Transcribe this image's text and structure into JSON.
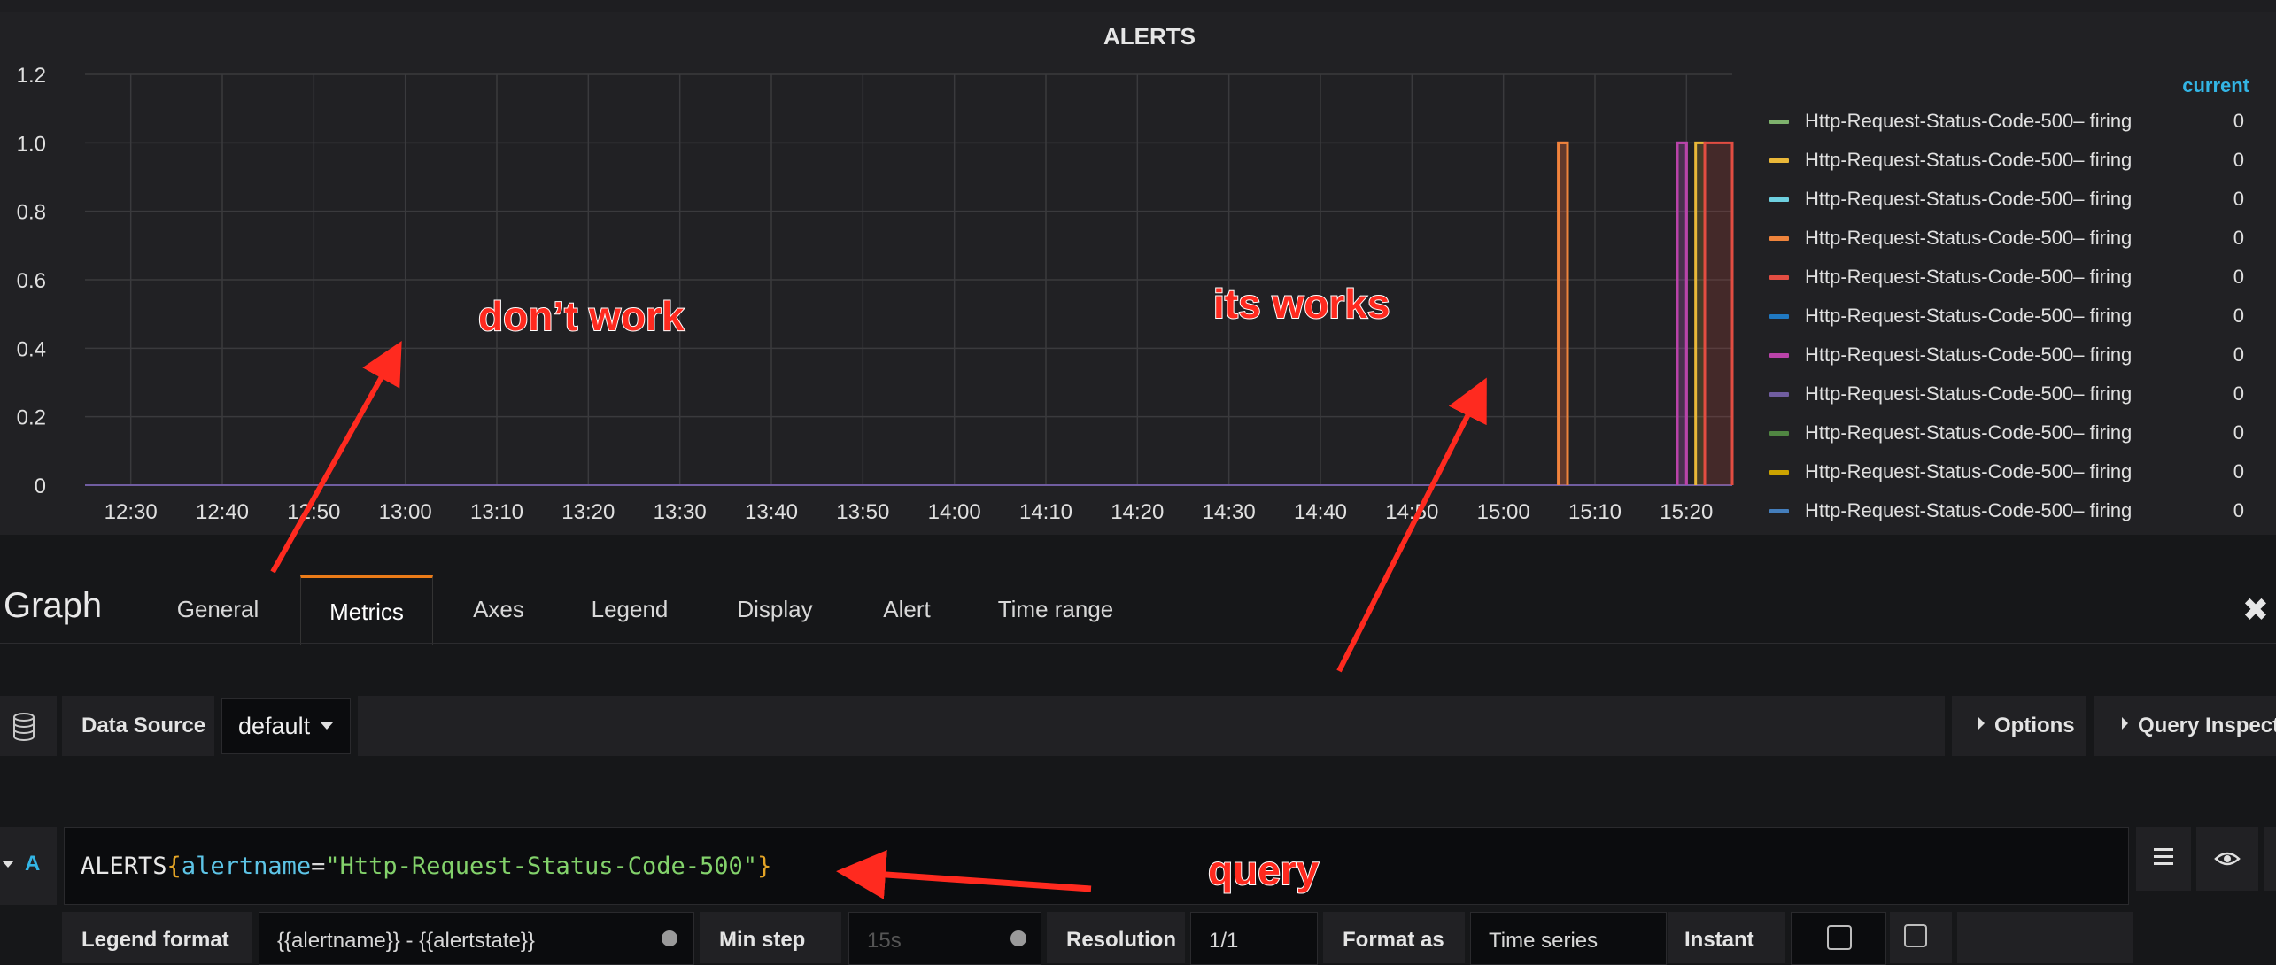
{
  "panel": {
    "title": "ALERTS",
    "legend": {
      "header": "current",
      "items": [
        {
          "name": "Http-Request-Status-Code-500– firing",
          "value": "0",
          "color": "#7eb26d"
        },
        {
          "name": "Http-Request-Status-Code-500– firing",
          "value": "0",
          "color": "#eab839"
        },
        {
          "name": "Http-Request-Status-Code-500– firing",
          "value": "0",
          "color": "#6ed0e0"
        },
        {
          "name": "Http-Request-Status-Code-500– firing",
          "value": "0",
          "color": "#ef843c"
        },
        {
          "name": "Http-Request-Status-Code-500– firing",
          "value": "0",
          "color": "#e24d42"
        },
        {
          "name": "Http-Request-Status-Code-500– firing",
          "value": "0",
          "color": "#1f78c1"
        },
        {
          "name": "Http-Request-Status-Code-500– firing",
          "value": "0",
          "color": "#ba43a9"
        },
        {
          "name": "Http-Request-Status-Code-500– firing",
          "value": "0",
          "color": "#705da0"
        },
        {
          "name": "Http-Request-Status-Code-500– firing",
          "value": "0",
          "color": "#508642"
        },
        {
          "name": "Http-Request-Status-Code-500– firing",
          "value": "0",
          "color": "#cca300"
        },
        {
          "name": "Http-Request-Status-Code-500– firing",
          "value": "0",
          "color": "#447ebc"
        }
      ]
    }
  },
  "chart_data": {
    "type": "line",
    "title": "ALERTS",
    "xlabel": "",
    "ylabel": "",
    "x_ticks": [
      "12:30",
      "12:40",
      "12:50",
      "13:00",
      "13:10",
      "13:20",
      "13:30",
      "13:40",
      "13:50",
      "14:00",
      "14:10",
      "14:20",
      "14:30",
      "14:40",
      "14:50",
      "15:00",
      "15:10",
      "15:20"
    ],
    "y_ticks": [
      "0",
      "0.2",
      "0.4",
      "0.6",
      "0.8",
      "1.0",
      "1.2"
    ],
    "ylim": [
      0,
      1.2
    ],
    "grid": true,
    "legend_position": "right",
    "series": [
      {
        "color": "#e24d42",
        "points": [
          [
            "15:06",
            0
          ],
          [
            "15:06",
            1
          ],
          [
            "15:07",
            1
          ],
          [
            "15:07",
            0
          ]
        ]
      },
      {
        "color": "#ef843c",
        "points": [
          [
            "15:06",
            0
          ],
          [
            "15:06",
            1
          ],
          [
            "15:07",
            1
          ],
          [
            "15:07",
            0
          ]
        ]
      },
      {
        "color": "#705da0",
        "points": [
          [
            "15:19",
            0
          ],
          [
            "15:19",
            1
          ],
          [
            "15:20",
            1
          ],
          [
            "15:20",
            0
          ]
        ]
      },
      {
        "color": "#ba43a9",
        "points": [
          [
            "15:19",
            0
          ],
          [
            "15:19",
            1
          ],
          [
            "15:20",
            1
          ],
          [
            "15:20",
            0
          ]
        ]
      },
      {
        "color": "#eab839",
        "points": [
          [
            "15:21",
            0
          ],
          [
            "15:21",
            1
          ],
          [
            "15:22",
            1
          ],
          [
            "15:22",
            0
          ]
        ]
      },
      {
        "color": "#6ed0e0",
        "points": [
          [
            "15:22",
            0
          ],
          [
            "15:22",
            1
          ],
          [
            "15:22",
            0
          ]
        ]
      },
      {
        "color": "#e24d42",
        "points": [
          [
            "15:22",
            0
          ],
          [
            "15:22",
            1
          ],
          [
            "15:25",
            1
          ],
          [
            "15:25",
            0
          ]
        ]
      }
    ]
  },
  "editor": {
    "panel_type": "Graph",
    "tabs": [
      "General",
      "Metrics",
      "Axes",
      "Legend",
      "Display",
      "Alert",
      "Time range"
    ],
    "active_tab": "Metrics",
    "data_source_label": "Data Source",
    "data_source_value": "default",
    "options_label": "Options",
    "query_inspector_label": "Query Inspecto",
    "query_ref": "A",
    "query": {
      "metric": "ALERTS",
      "open": "{",
      "label": "alertname",
      "eq": "=",
      "value": "\"Http-Request-Status-Code-500\"",
      "close": "}"
    },
    "bottom_row": {
      "legend_format_label": "Legend format",
      "legend_format_value": "{{alertname}} - {{alertstate}}",
      "min_step_label": "Min step",
      "min_step_placeholder": "15s",
      "resolution_label": "Resolution",
      "resolution_value": "1/1",
      "format_label": "Format as",
      "time_series_label": "Time series",
      "instant_label": "Instant"
    }
  },
  "annotations": {
    "dont_work": "don’t work",
    "its_works": "its works",
    "query": "query"
  }
}
